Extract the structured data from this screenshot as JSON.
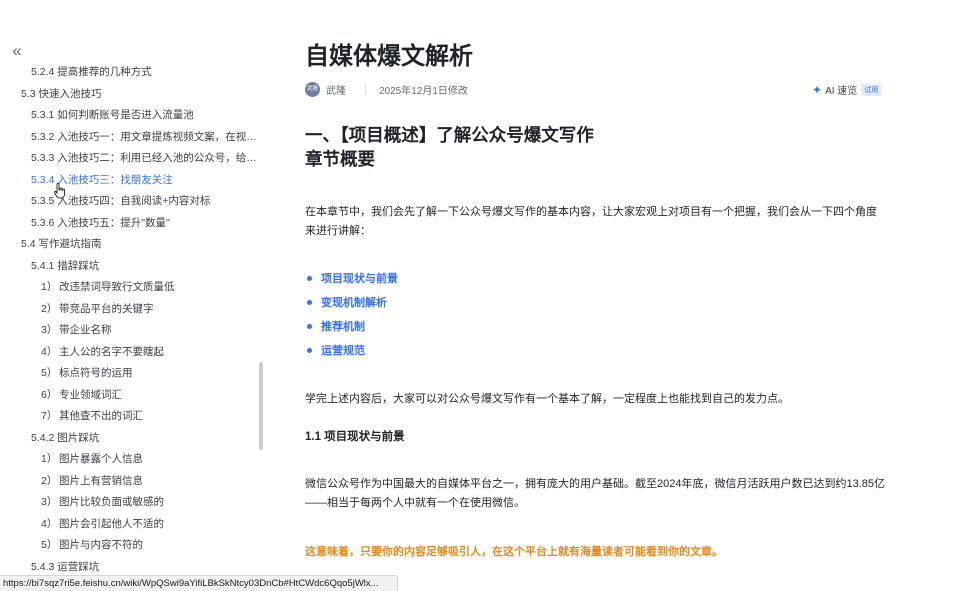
{
  "sidebar": {
    "collapse_glyph": "«",
    "items": [
      {
        "label": "5.2.4 提高推荐的几种方式",
        "level": 3
      },
      {
        "label": "5.3 快速入池技巧",
        "level": 2
      },
      {
        "label": "5.3.1 如何判断账号是否进入流量池",
        "level": 3
      },
      {
        "label": "5.3.2 入池技巧一：用文章提炼视频文案，在视频...",
        "level": 3
      },
      {
        "label": "5.3.3 入池技巧二：利用已经入池的公众号，给未...",
        "level": 3
      },
      {
        "label": "5.3.4 入池技巧三：找朋友关注",
        "level": 3,
        "active": true
      },
      {
        "label": "5.3.5 入池技巧四：自我阅读+内容对标",
        "level": 3
      },
      {
        "label": "5.3.6 入池技巧五：提升\"数量\"",
        "level": 3
      },
      {
        "label": "5.4 写作避坑指南",
        "level": 2
      },
      {
        "label": "5.4.1 措辞踩坑",
        "level": 3
      },
      {
        "num": "1）",
        "label": "改违禁词导致行文质量低",
        "level": 4
      },
      {
        "num": "2）",
        "label": "带竞品平台的关键字",
        "level": 4
      },
      {
        "num": "3）",
        "label": "带企业名称",
        "level": 4
      },
      {
        "num": "4）",
        "label": "主人公的名字不要瞎起",
        "level": 4
      },
      {
        "num": "5）",
        "label": "标点符号的运用",
        "level": 4
      },
      {
        "num": "6）",
        "label": "专业领域词汇",
        "level": 4
      },
      {
        "num": "7）",
        "label": "其他查不出的词汇",
        "level": 4
      },
      {
        "label": "5.4.2 图片踩坑",
        "level": 3
      },
      {
        "num": "1）",
        "label": "图片暴露个人信息",
        "level": 4
      },
      {
        "num": "2）",
        "label": "图片上有营销信息",
        "level": 4
      },
      {
        "num": "3）",
        "label": "图片比较负面或敏感的",
        "level": 4
      },
      {
        "num": "4）",
        "label": "图片会引起他人不适的",
        "level": 4
      },
      {
        "num": "5）",
        "label": "图片与内容不符的",
        "level": 4
      },
      {
        "label": "5.4.3 运营踩坑",
        "level": 3
      }
    ]
  },
  "doc": {
    "title": "自媒体爆文解析",
    "author_avatar": "武隆",
    "author": "武隆",
    "modified": "2025年12月1日修改",
    "ai_label": "AI 速览",
    "trial_badge": "试用",
    "h1_line1": "一、【项目概述】了解公众号爆文写作",
    "h1_line2": "章节概要",
    "intro": "在本章节中，我们会先了解一下公众号爆文写作的基本内容，让大家宏观上对项目有一个把握，我们会从一下四个角度来进行讲解：",
    "bullets": [
      "项目现状与前景",
      "变现机制解析",
      "推荐机制",
      "运营规范"
    ],
    "summary": "学完上述内容后，大家可以对公众号爆文写作有一个基本了解，一定程度上也能找到自己的发力点。",
    "h2": "1.1 项目现状与前景",
    "body": "微信公众号作为中国最大的自媒体平台之一，拥有庞大的用户基础。截至2024年底，微信月活跃用户数已达到约13.85亿 ——相当于每两个人中就有一个在使用微信。",
    "highlight": "这意味着，只要你的内容足够吸引人，在这个平台上就有海量读者可能看到你的文章。"
  },
  "statusbar": {
    "url": "https://bi7sqz7ri5e.feishu.cn/wiki/WpQSwi9aYifiLBkSkNtcy03DnCb#HtCWdc6Qqo5jWlx..."
  },
  "colors": {
    "accent": "#3370ff",
    "highlight": "#e8881a",
    "text": "#1f2329"
  }
}
